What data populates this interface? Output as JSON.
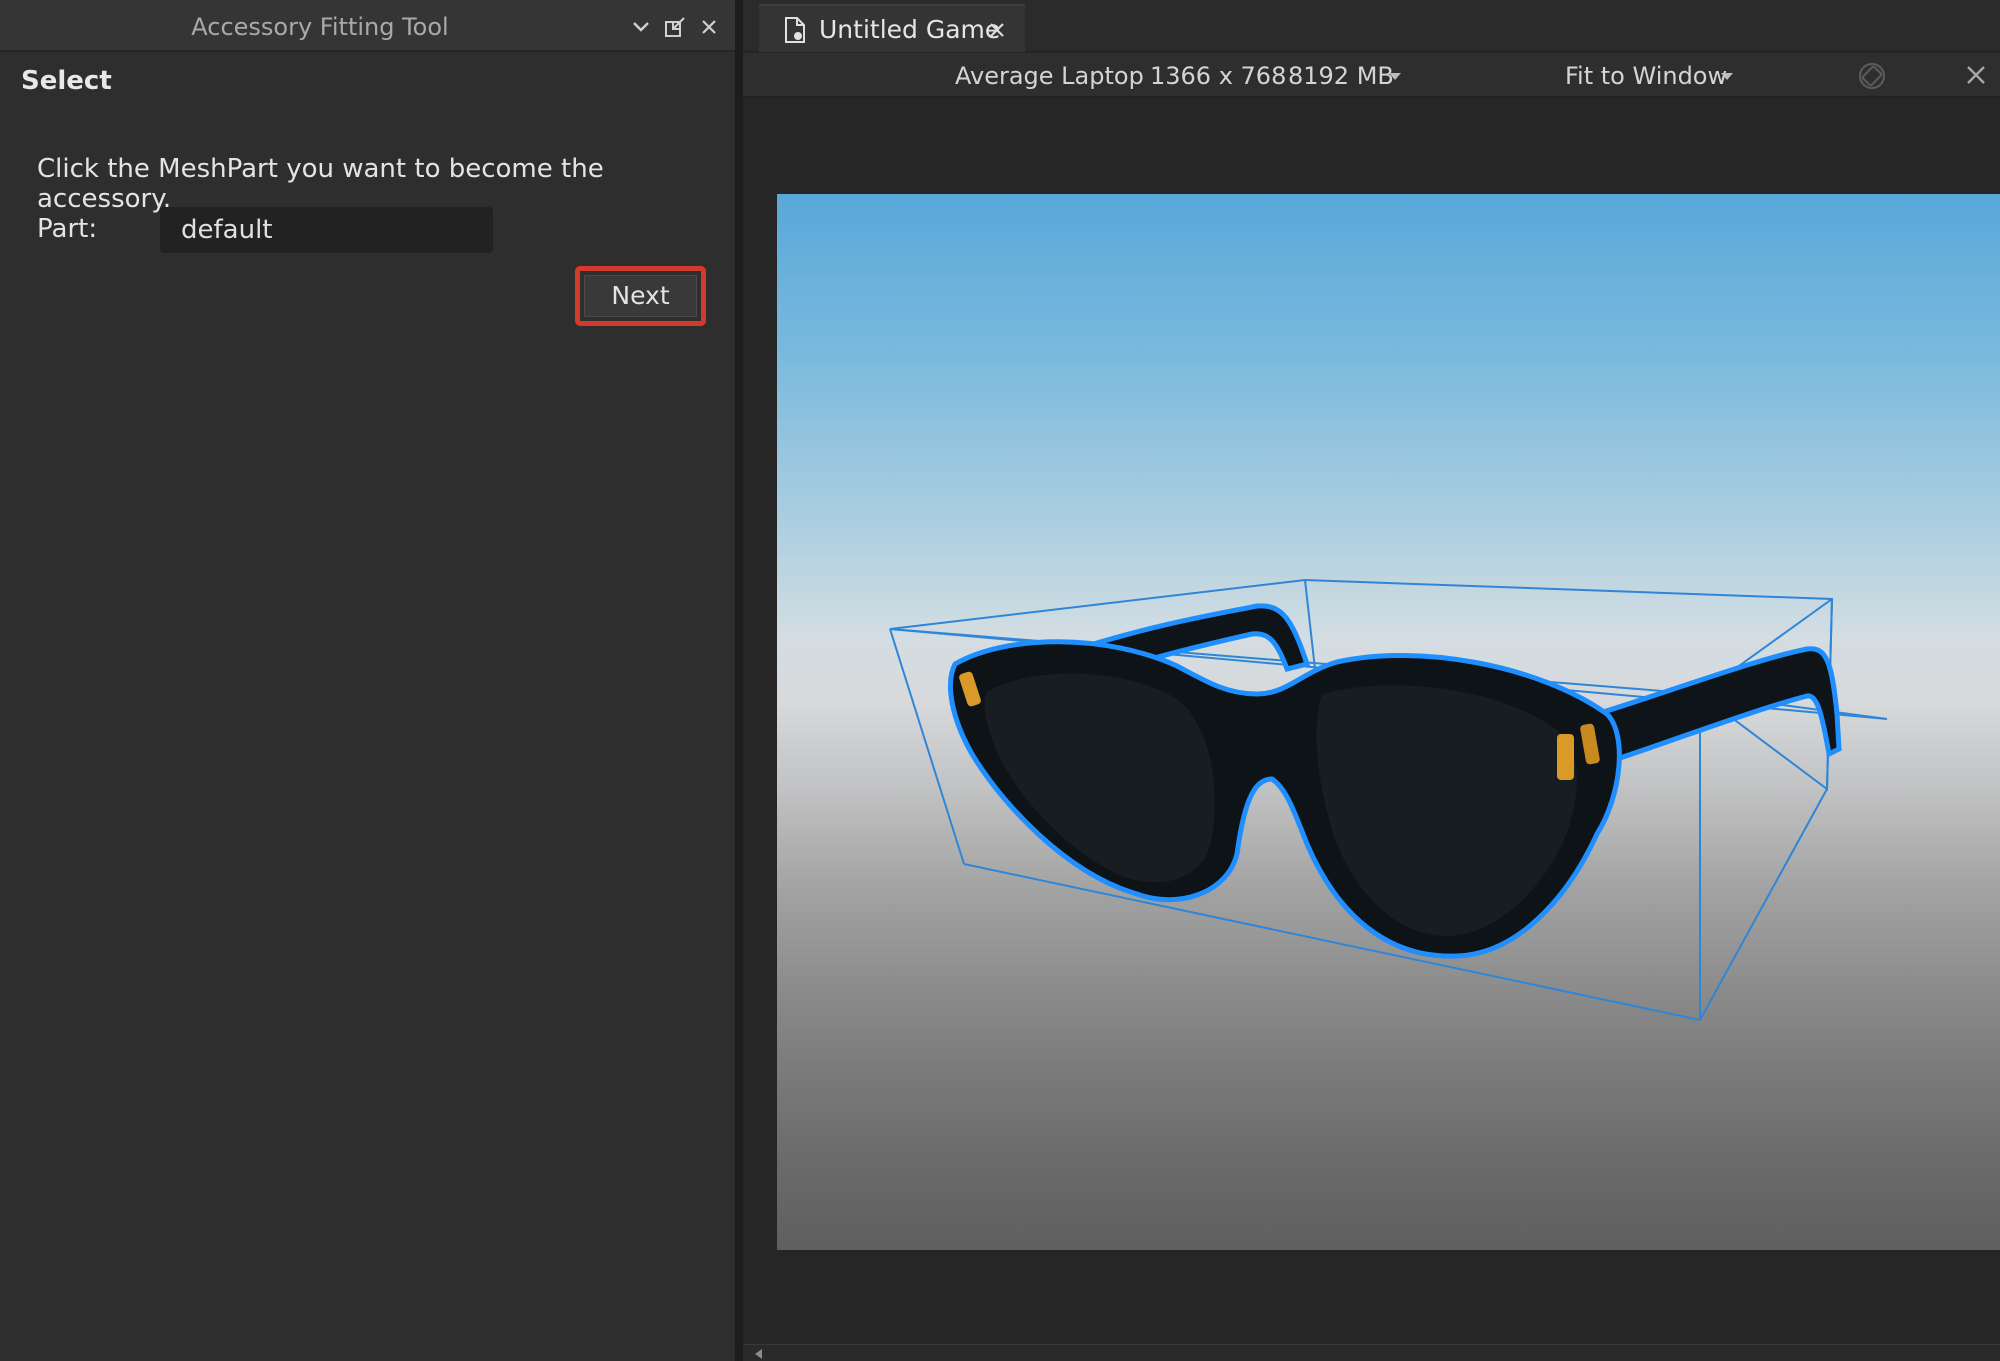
{
  "panel": {
    "title": "Accessory Fitting Tool",
    "section": "Select",
    "instruction": "Click the MeshPart you want to become the accessory.",
    "part_label": "Part:",
    "part_value": "default",
    "next_label": "Next",
    "highlight_color": "#d23b2b"
  },
  "tab": {
    "label": "Untitled Game"
  },
  "device_bar": {
    "device": "Average Laptop",
    "resolution": "1366 x 768",
    "memory": "8192 MB",
    "fit": "Fit to Window"
  },
  "viewport": {
    "selection_color": "#1f8fff",
    "accent_color": "#d99a28"
  }
}
